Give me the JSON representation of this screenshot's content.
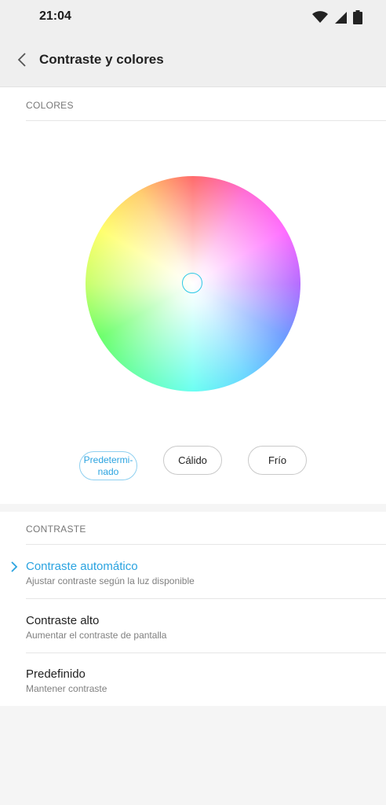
{
  "status_bar": {
    "time": "21:04"
  },
  "app_bar": {
    "title": "Contraste y colores"
  },
  "colors_section": {
    "header": "COLORES",
    "presets": [
      {
        "label": "Predetermi-\nnado",
        "selected": true
      },
      {
        "label": "Cálido",
        "selected": false
      },
      {
        "label": "Frío",
        "selected": false
      }
    ]
  },
  "contrast_section": {
    "header": "CONTRASTE",
    "items": [
      {
        "title": "Contraste automático",
        "subtitle": "Ajustar contraste según la luz disponible",
        "selected": true
      },
      {
        "title": "Contraste alto",
        "subtitle": "Aumentar el contraste de pantalla",
        "selected": false
      },
      {
        "title": "Predefinido",
        "subtitle": "Mantener contraste",
        "selected": false
      }
    ]
  },
  "colors": {
    "accent": "#2aa3e0",
    "picker_ring": "#2ec9e6"
  }
}
